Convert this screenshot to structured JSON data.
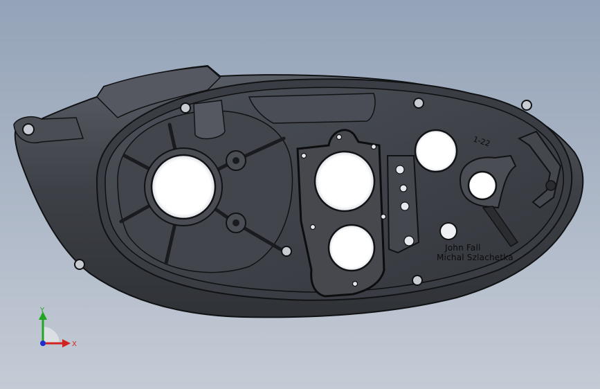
{
  "model": {
    "part_label": "1-22",
    "engraving_line_1": "John Fall",
    "engraving_line_2": "Michal Szlachetka"
  },
  "triad": {
    "y_label": "Y",
    "x_label": "X",
    "y_color": "#22a622",
    "x_color": "#d22222",
    "z_color": "#1e2fd0"
  },
  "colors": {
    "background_top": "#94a3b8",
    "background_bottom": "#c4cbd5",
    "part_body": "#3d4046",
    "part_highlight": "#5a5e66",
    "gasket": "#4a4c52",
    "outline": "#111214"
  }
}
